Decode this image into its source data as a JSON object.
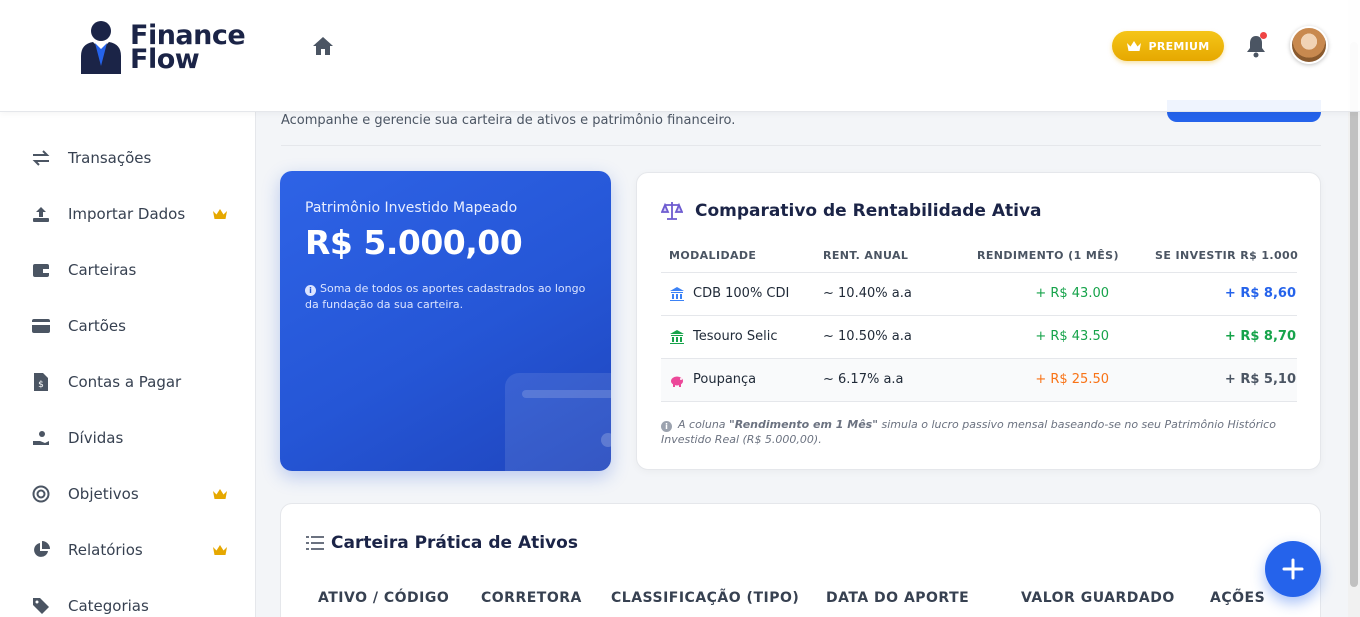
{
  "app": {
    "logo_line1": "Finance",
    "logo_line2": "Flow"
  },
  "header": {
    "premium_label": "PREMIUM",
    "notification_dot": true
  },
  "sidebar": {
    "items": [
      {
        "label": "Transações",
        "icon": "arrows-exchange-icon",
        "premium": false
      },
      {
        "label": "Importar Dados",
        "icon": "upload-icon",
        "premium": true
      },
      {
        "label": "Carteiras",
        "icon": "wallet-icon",
        "premium": false
      },
      {
        "label": "Cartões",
        "icon": "credit-card-icon",
        "premium": false
      },
      {
        "label": "Contas a Pagar",
        "icon": "invoice-icon",
        "premium": false
      },
      {
        "label": "Dívidas",
        "icon": "hand-money-icon",
        "premium": false
      },
      {
        "label": "Objetivos",
        "icon": "target-icon",
        "premium": true
      },
      {
        "label": "Relatórios",
        "icon": "pie-chart-icon",
        "premium": true
      },
      {
        "label": "Categorias",
        "icon": "tag-icon",
        "premium": false
      }
    ]
  },
  "page": {
    "subtitle": "Acompanhe e gerencie sua carteira de ativos e patrimônio financeiro."
  },
  "patrimonio": {
    "title": "Patrimônio Investido Mapeado",
    "value": "R$ 5.000,00",
    "note": "Soma de todos os aportes cadastrados ao longo da fundação da sua carteira."
  },
  "comparativo": {
    "title": "Comparativo de Rentabilidade Ativa",
    "headers": [
      "MODALIDADE",
      "RENT. ANUAL",
      "RENDIMENTO (1 MÊS)",
      "SE INVESTIR R$ 1.000"
    ],
    "rows": [
      {
        "name": "CDB 100% CDI",
        "rate": "~ 10.40% a.a",
        "yield": "+ R$ 43.00",
        "invest": "+ R$ 8,60",
        "icon": "bank-icon",
        "icon_color": "#3b82f6",
        "yield_color": "#16a34a",
        "invest_color": "#2563eb"
      },
      {
        "name": "Tesouro Selic",
        "rate": "~ 10.50% a.a",
        "yield": "+ R$ 43.50",
        "invest": "+ R$ 8,70",
        "icon": "bank-icon",
        "icon_color": "#16a34a",
        "yield_color": "#16a34a",
        "invest_color": "#16a34a"
      },
      {
        "name": "Poupança",
        "rate": "~ 6.17% a.a",
        "yield": "+ R$ 25.50",
        "invest": "+ R$ 5,10",
        "icon": "piggy-bank-icon",
        "icon_color": "#ec4899",
        "yield_color": "#f97316",
        "invest_color": "#4b5563"
      }
    ],
    "footnote_prefix": "A coluna ",
    "footnote_bold": "\"Rendimento em 1 Mês\"",
    "footnote_suffix": " simula o lucro passivo mensal baseando-se no seu Patrimônio Histórico Investido Real (R$ 5.000,00)."
  },
  "carteira": {
    "title": "Carteira Prática de Ativos",
    "headers": [
      "ATIVO / CÓDIGO",
      "CORRETORA",
      "CLASSIFICAÇÃO (TIPO)",
      "DATA DO APORTE",
      "VALOR GUARDADO",
      "AÇÕES"
    ]
  },
  "colors": {
    "primary": "#2563eb",
    "premium": "#f5c518",
    "crown": "#e6a800"
  }
}
